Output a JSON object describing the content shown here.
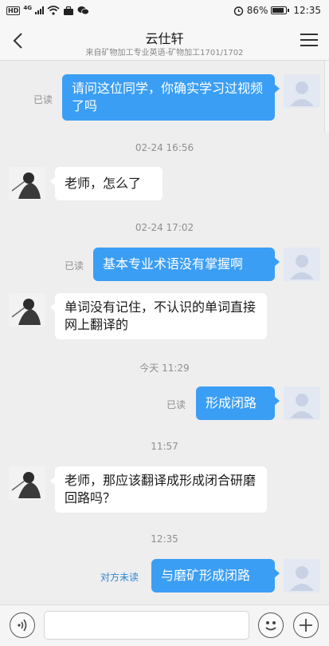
{
  "status_bar": {
    "hd": "HD",
    "network": "4G",
    "battery_percent": "86%",
    "battery_level": 0.86,
    "time": "12:35"
  },
  "header": {
    "title": "云仕轩",
    "subtitle": "来自矿物加工专业英语-矿物加工1701/1702"
  },
  "messages": [
    {
      "type": "out",
      "text": "请问这位同学，你确实学习过视频了吗",
      "status": "已读"
    },
    {
      "type": "time",
      "text": "02-24 16:56"
    },
    {
      "type": "in",
      "text": "老师，怎么了"
    },
    {
      "type": "time",
      "text": "02-24 17:02"
    },
    {
      "type": "out",
      "text": "基本专业术语没有掌握啊",
      "status": "已读"
    },
    {
      "type": "in",
      "text": "单词没有记住，不认识的单词直接网上翻译的"
    },
    {
      "type": "time",
      "text": "今天 11:29"
    },
    {
      "type": "out",
      "text": "形成闭路",
      "status": "已读"
    },
    {
      "type": "time",
      "text": "11:57"
    },
    {
      "type": "in",
      "text": "老师，那应该翻译成形成闭合研磨回路吗？"
    },
    {
      "type": "time",
      "text": "12:35"
    },
    {
      "type": "out",
      "text": "与磨矿形成闭路",
      "status": "对方未读"
    }
  ],
  "input": {
    "value": "",
    "placeholder": ""
  },
  "icons": {
    "back": "chevron-left-icon",
    "menu": "hamburger-menu-icon",
    "voice": "voice-icon",
    "emoji": "emoji-icon",
    "plus": "plus-icon"
  },
  "colors": {
    "outgoing_bubble": "#3b9ef5",
    "incoming_bubble": "#ffffff",
    "unread_status": "#2f86d6",
    "background": "#eeeeee"
  }
}
